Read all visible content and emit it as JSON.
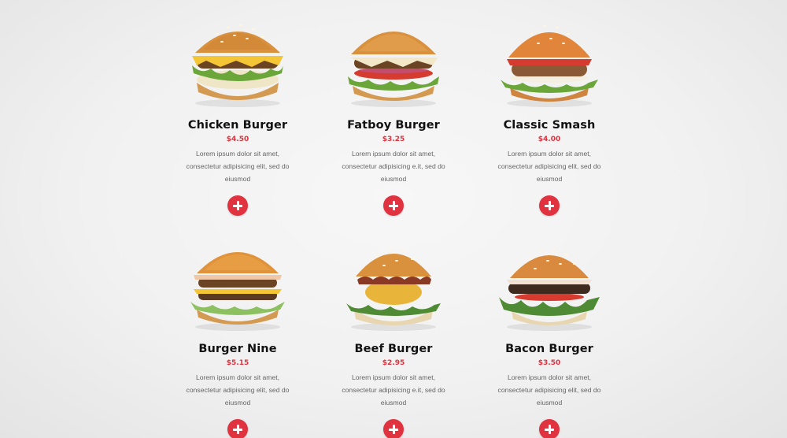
{
  "colors": {
    "accent": "#e0323f",
    "title": "#111111",
    "text": "#666666",
    "bun": "#d9913e",
    "patty": "#5b3a24",
    "cheese": "#f4c534",
    "lettuce": "#6aa63a",
    "tomato": "#d63b2f"
  },
  "menu": {
    "items": [
      {
        "name": "Chicken Burger",
        "price": "$4.50",
        "desc": "Lorem ipsum dolor sit amet, consectetur adipisicing elit, sed do eiusmod",
        "icon": "add-to-cart-icon"
      },
      {
        "name": "Fatboy Burger",
        "price": "$3.25",
        "desc": "Lorem ipsum dolor sit amet, consectetur adipisicing e.it, sed do eiusmod",
        "icon": "add-to-cart-icon"
      },
      {
        "name": "Classic Smash",
        "price": "$4.00",
        "desc": "Lorem ipsum dolor sit amet, consectetur adipisicing elit, sed do eiusmod",
        "icon": "add-to-cart-icon"
      },
      {
        "name": "Burger Nine",
        "price": "$5.15",
        "desc": "Lorem ipsum dolor sit amet, consectetur adipisicing elit, sed do eiusmod",
        "icon": "add-to-cart-icon"
      },
      {
        "name": "Beef Burger",
        "price": "$2.95",
        "desc": "Lorem ipsum dolor sit amet, consectetur adipisicing e.it, sed do eiusmod",
        "icon": "add-to-cart-icon"
      },
      {
        "name": "Bacon Burger",
        "price": "$3.50",
        "desc": "Lorem ipsum dolor sit amet, consectetur adipisicing elit, sed do eiusmod",
        "icon": "add-to-cart-icon"
      }
    ]
  }
}
